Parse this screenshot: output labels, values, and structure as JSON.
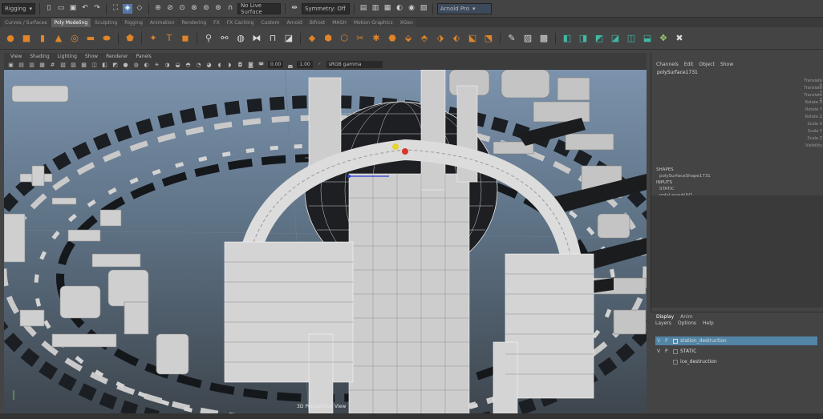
{
  "statusline": {
    "menuset": "Rigging",
    "no_live_surface": "No Live Surface",
    "symmetry": "Symmetry: Off",
    "workspace": "Arnold Pro"
  },
  "shelf_tabs": [
    "Curves / Surfaces",
    "Poly Modeling",
    "Sculpting",
    "Rigging",
    "Animation",
    "Rendering",
    "FX",
    "FX Caching",
    "Custom",
    "Arnold",
    "Bifrost",
    "MASH",
    "Motion Graphics",
    "XGen"
  ],
  "panel_menu": [
    "View",
    "Shading",
    "Lighting",
    "Show",
    "Renderer",
    "Panels"
  ],
  "panel_toolbar": {
    "field_a": "0.00",
    "field_b": "1.00",
    "colorspace": "sRGB gamma"
  },
  "viewport": {
    "camera_label": "3D Perspective View"
  },
  "channel_box": {
    "menu": [
      "Channels",
      "Edit",
      "Object",
      "Show"
    ],
    "object_name": "polySurface1731",
    "channels": [
      "Translate X",
      "Translate Y",
      "Translate Z",
      "Rotate X",
      "Rotate Y",
      "Rotate Z",
      "Scale X",
      "Scale Y",
      "Scale Z",
      "Visibility"
    ],
    "shapes_header": "SHAPES",
    "shape_name": "polySurfaceShape1731",
    "inputs_header": "INPUTS",
    "input_1": "STATIC",
    "input_2": "polyLayoutUV1"
  },
  "layer_editor": {
    "tabs": [
      "Display",
      "Anim"
    ],
    "menu": [
      "Layers",
      "Options",
      "Help"
    ],
    "layers": [
      {
        "v": "V",
        "p": "P",
        "name": "station_destruction",
        "selected": true
      },
      {
        "v": "V",
        "p": "P",
        "name": "STATIC",
        "selected": false
      },
      {
        "v": "",
        "p": "",
        "name": "ice_destruction",
        "selected": false
      }
    ]
  },
  "colors": {
    "accent_blue": "#5285a6",
    "shelf_orange": "#e0842a",
    "shelf_teal": "#3fb9a6"
  }
}
